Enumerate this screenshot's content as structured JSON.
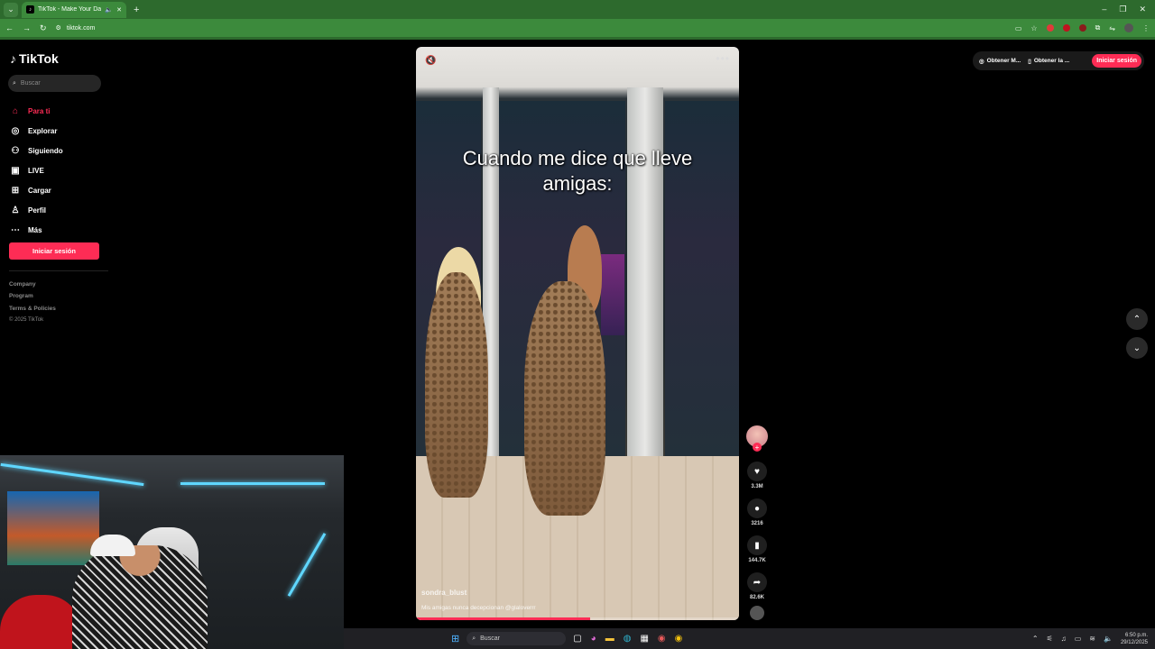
{
  "browser": {
    "tab_title": "TikTok - Make Your Day",
    "url": "tiktok.com",
    "new_tab_label": "+",
    "window_minimize": "–",
    "window_restore": "❐",
    "window_close": "✕"
  },
  "sidebar": {
    "brand": "TikTok",
    "search_placeholder": "Buscar",
    "items": [
      {
        "label": "Para ti",
        "icon": "home-icon",
        "glyph": "⌂"
      },
      {
        "label": "Explorar",
        "icon": "compass-icon",
        "glyph": "◎"
      },
      {
        "label": "Siguiendo",
        "icon": "following-icon",
        "glyph": "⚇"
      },
      {
        "label": "LIVE",
        "icon": "live-icon",
        "glyph": "▣"
      },
      {
        "label": "Cargar",
        "icon": "upload-icon",
        "glyph": "⊞"
      },
      {
        "label": "Perfil",
        "icon": "profile-icon",
        "glyph": "♙"
      },
      {
        "label": "Más",
        "icon": "more-icon",
        "glyph": "⋯"
      }
    ],
    "login_button": "Iniciar sesión",
    "footer": {
      "company": "Company",
      "program": "Program",
      "terms": "Terms & Policies",
      "copyright": "© 2025 TikTok"
    }
  },
  "video": {
    "overlay_text_line1": "Cuando me dice que lleve",
    "overlay_text_line2": "amigas:",
    "author": "sondra_blust",
    "description": "Mis amigas nunca decepcionan @glaloverrr",
    "progress": 0.54
  },
  "actions": {
    "likes": "3.3M",
    "comments": "3216",
    "saves": "144.7K",
    "shares": "82.6K"
  },
  "topbar": {
    "get_app_1": "Obtener M...",
    "get_app_2": "Obtener la ...",
    "login": "Iniciar sesión"
  },
  "taskbar": {
    "search_label": "Buscar",
    "time": "6:50 p.m.",
    "date": "29/12/2025"
  },
  "colors": {
    "accent": "#fe2c55",
    "browser_frame": "#3c8a3c"
  }
}
